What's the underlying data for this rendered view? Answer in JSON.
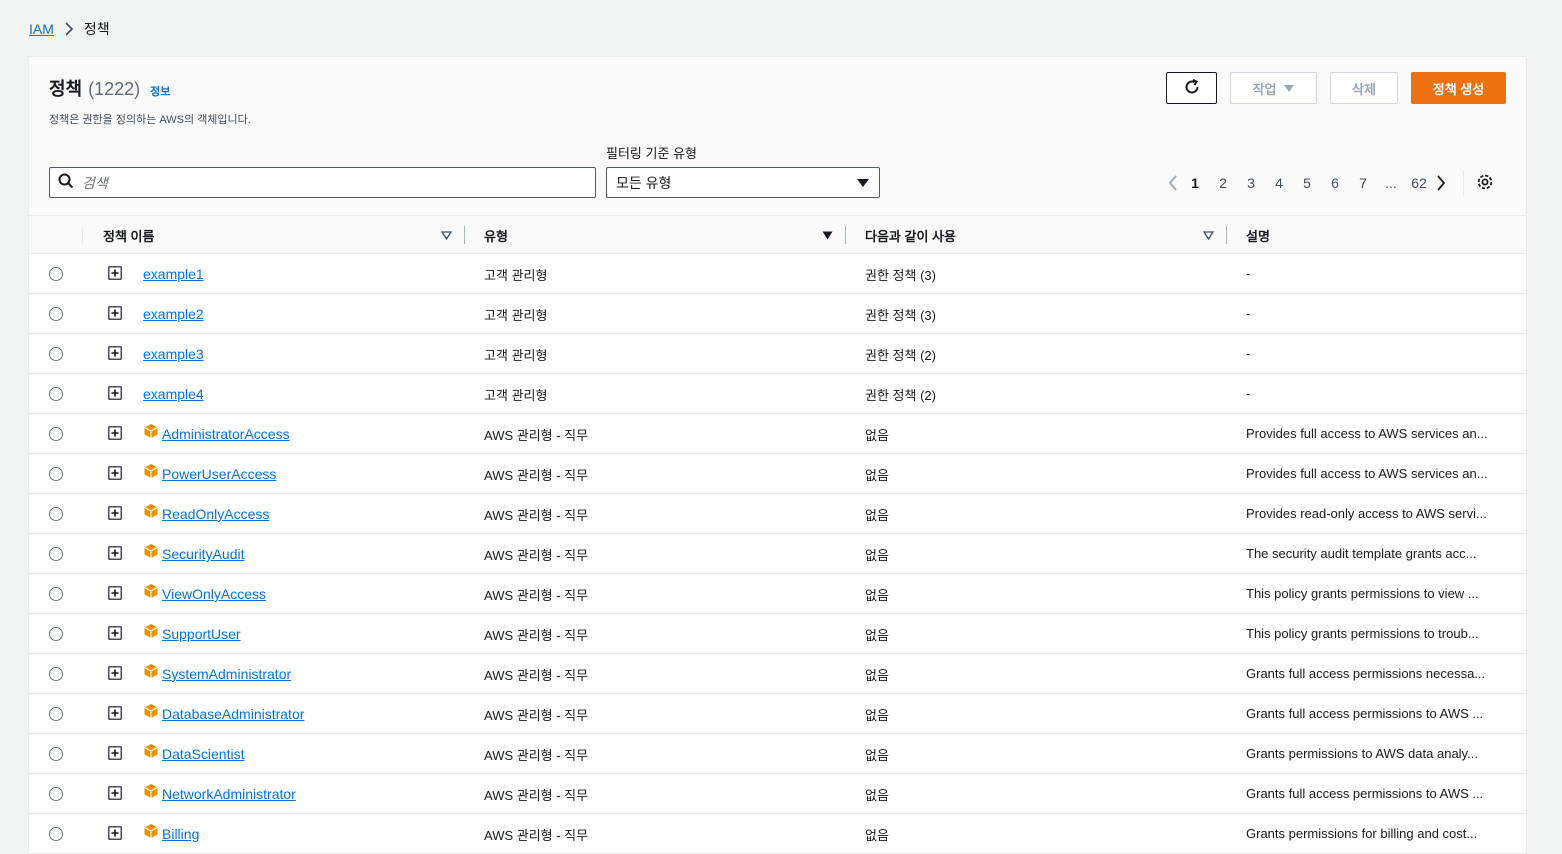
{
  "breadcrumb": {
    "root": "IAM",
    "current": "정책"
  },
  "panel": {
    "title": "정책",
    "count": "(1222)",
    "info_link": "정보",
    "description": "정책은 권한을 정의하는 AWS의 객체입니다."
  },
  "actions": {
    "action_label": "작업",
    "delete_label": "삭제",
    "create_label": "정책 생성"
  },
  "search": {
    "placeholder": "검색"
  },
  "filter": {
    "label": "필터링 기준 유형",
    "selected": "모든 유형"
  },
  "pagination": {
    "pages": [
      "1",
      "2",
      "3",
      "4",
      "5",
      "6",
      "7",
      "...",
      "62"
    ],
    "current": "1"
  },
  "table": {
    "headers": {
      "name": "정책 이름",
      "type": "유형",
      "used_as": "다음과 같이 사용",
      "description": "설명"
    },
    "rows": [
      {
        "name": "example1",
        "aws_managed": false,
        "type": "고객 관리형",
        "used_as": "권한 정책 (3)",
        "description": "-"
      },
      {
        "name": "example2",
        "aws_managed": false,
        "type": "고객 관리형",
        "used_as": "권한 정책 (3)",
        "description": "-"
      },
      {
        "name": "example3",
        "aws_managed": false,
        "type": "고객 관리형",
        "used_as": "권한 정책 (2)",
        "description": "-"
      },
      {
        "name": "example4",
        "aws_managed": false,
        "type": "고객 관리형",
        "used_as": "권한 정책 (2)",
        "description": "-"
      },
      {
        "name": "AdministratorAccess",
        "aws_managed": true,
        "type": "AWS 관리형 - 직무",
        "used_as": "없음",
        "description": "Provides full access to AWS services an..."
      },
      {
        "name": "PowerUserAccess",
        "aws_managed": true,
        "type": "AWS 관리형 - 직무",
        "used_as": "없음",
        "description": "Provides full access to AWS services an..."
      },
      {
        "name": "ReadOnlyAccess",
        "aws_managed": true,
        "type": "AWS 관리형 - 직무",
        "used_as": "없음",
        "description": "Provides read-only access to AWS servi..."
      },
      {
        "name": "SecurityAudit",
        "aws_managed": true,
        "type": "AWS 관리형 - 직무",
        "used_as": "없음",
        "description": "The security audit template grants acc..."
      },
      {
        "name": "ViewOnlyAccess",
        "aws_managed": true,
        "type": "AWS 관리형 - 직무",
        "used_as": "없음",
        "description": "This policy grants permissions to view ..."
      },
      {
        "name": "SupportUser",
        "aws_managed": true,
        "type": "AWS 관리형 - 직무",
        "used_as": "없음",
        "description": "This policy grants permissions to troub..."
      },
      {
        "name": "SystemAdministrator",
        "aws_managed": true,
        "type": "AWS 관리형 - 직무",
        "used_as": "없음",
        "description": "Grants full access permissions necessa..."
      },
      {
        "name": "DatabaseAdministrator",
        "aws_managed": true,
        "type": "AWS 관리형 - 직무",
        "used_as": "없음",
        "description": "Grants full access permissions to AWS ..."
      },
      {
        "name": "DataScientist",
        "aws_managed": true,
        "type": "AWS 관리형 - 직무",
        "used_as": "없음",
        "description": "Grants permissions to AWS data analy..."
      },
      {
        "name": "NetworkAdministrator",
        "aws_managed": true,
        "type": "AWS 관리형 - 직무",
        "used_as": "없음",
        "description": "Grants full access permissions to AWS ..."
      },
      {
        "name": "Billing",
        "aws_managed": true,
        "type": "AWS 관리형 - 직무",
        "used_as": "없음",
        "description": "Grants permissions for billing and cost..."
      }
    ]
  },
  "colors": {
    "link": "#0972d3",
    "primary": "#ec7211",
    "aws_icon": "#f29100"
  }
}
